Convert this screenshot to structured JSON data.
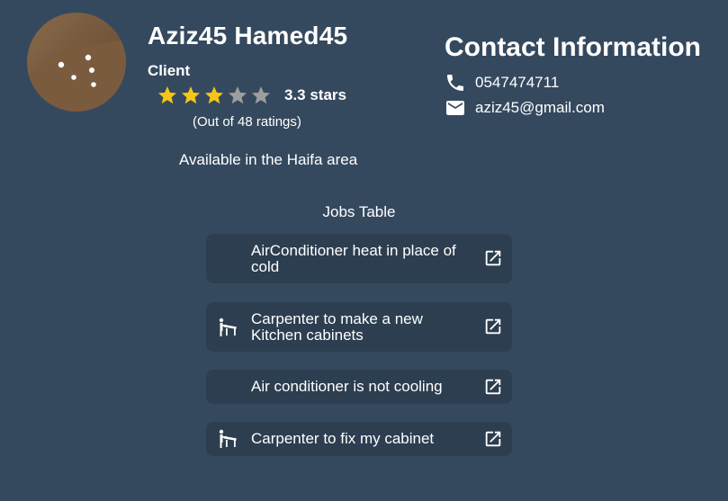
{
  "profile": {
    "name": "Aziz45 Hamed45",
    "role": "Client",
    "stars_text": "3.3 stars",
    "rating": 3.3,
    "rating_max": 5,
    "ratings_count": "(Out of 48 ratings)",
    "availability": "Available in the Haifa area"
  },
  "contact": {
    "title": "Contact Information",
    "phone": "0547474711",
    "email": "aziz45@gmail.com"
  },
  "jobs": {
    "title": "Jobs Table",
    "items": [
      {
        "label": "AirConditioner heat in place of cold",
        "icon": "none"
      },
      {
        "label": "Carpenter to make a new Kitchen cabinets",
        "icon": "carpenter-icon"
      },
      {
        "label": "Air conditioner is not cooling",
        "icon": "none"
      },
      {
        "label": "Carpenter to fix my cabinet",
        "icon": "carpenter-icon"
      }
    ]
  },
  "colors": {
    "background": "#35495e",
    "card": "#2c3e50",
    "star_filled": "#f5c518",
    "star_empty": "#9e9e9e"
  }
}
